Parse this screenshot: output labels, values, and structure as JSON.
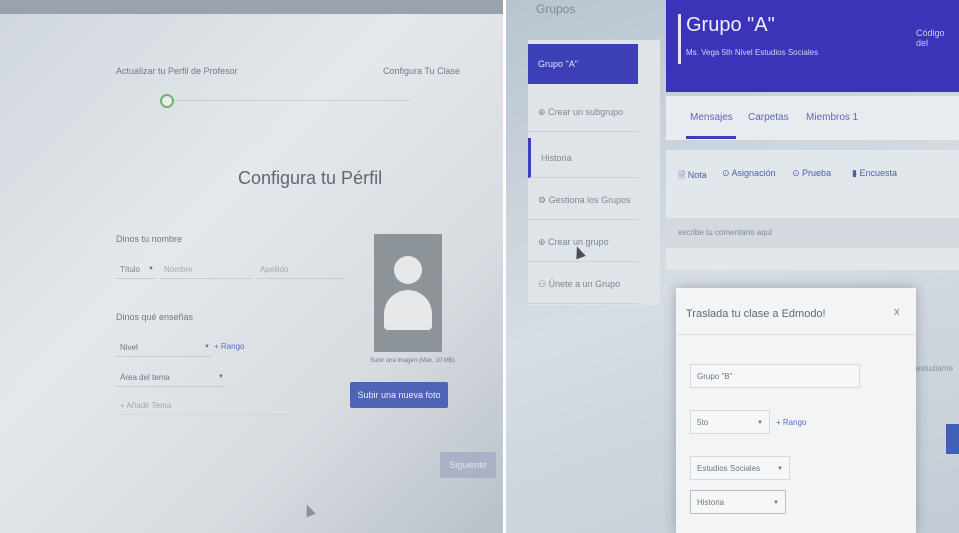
{
  "left": {
    "steps": {
      "step1": "Actualizar tu Perfil de Profesor",
      "step2": "Configura Tu Clase"
    },
    "title": "Configura tu Pérfil",
    "name_label": "Dinos tu nombre",
    "title_select": "Título",
    "first_name_placeholder": "Nombre",
    "last_name_placeholder": "Apellido",
    "teach_label": "Dinos qué enseñas",
    "level_select": "Nivel",
    "range_link": "+ Rango",
    "subject_area": "Área del tema",
    "add_subject": "+ Añadir Tema",
    "photo_hint": "Subir una imagen (Máx. 10 MB)",
    "upload_button": "Subir una nueva foto",
    "next_button": "Siguiente"
  },
  "right": {
    "sidebar": {
      "header": "Grupos",
      "items": [
        "Grupo \"A\"",
        "⊕ Crear un subgrupo",
        "Historia",
        "⚙ Gestiona los Grupos",
        "⊕ Crear un grupo",
        "⚇ Únete a un Grupo"
      ]
    },
    "group": {
      "title": "Grupo \"A\"",
      "subtitle": "Ms. Vega   5th Nivel   Estudios Sociales",
      "code_label": "Código del"
    },
    "tabs": [
      "Mensajes",
      "Carpetas",
      "Miembros 1"
    ],
    "post_tabs": [
      "Nota",
      "Asignación",
      "Prueba",
      "Encuesta"
    ],
    "comment_placeholder": "escribe tu comentario aquí",
    "modal": {
      "title": "Traslada tu clase a Edmodo!",
      "close": "x",
      "group_name": "Grupo \"B\"",
      "level": "5to",
      "range_link": "+ Rango",
      "subject": "Estudios Sociales",
      "subsubject": "Historia"
    },
    "side_text": "estudiante"
  }
}
